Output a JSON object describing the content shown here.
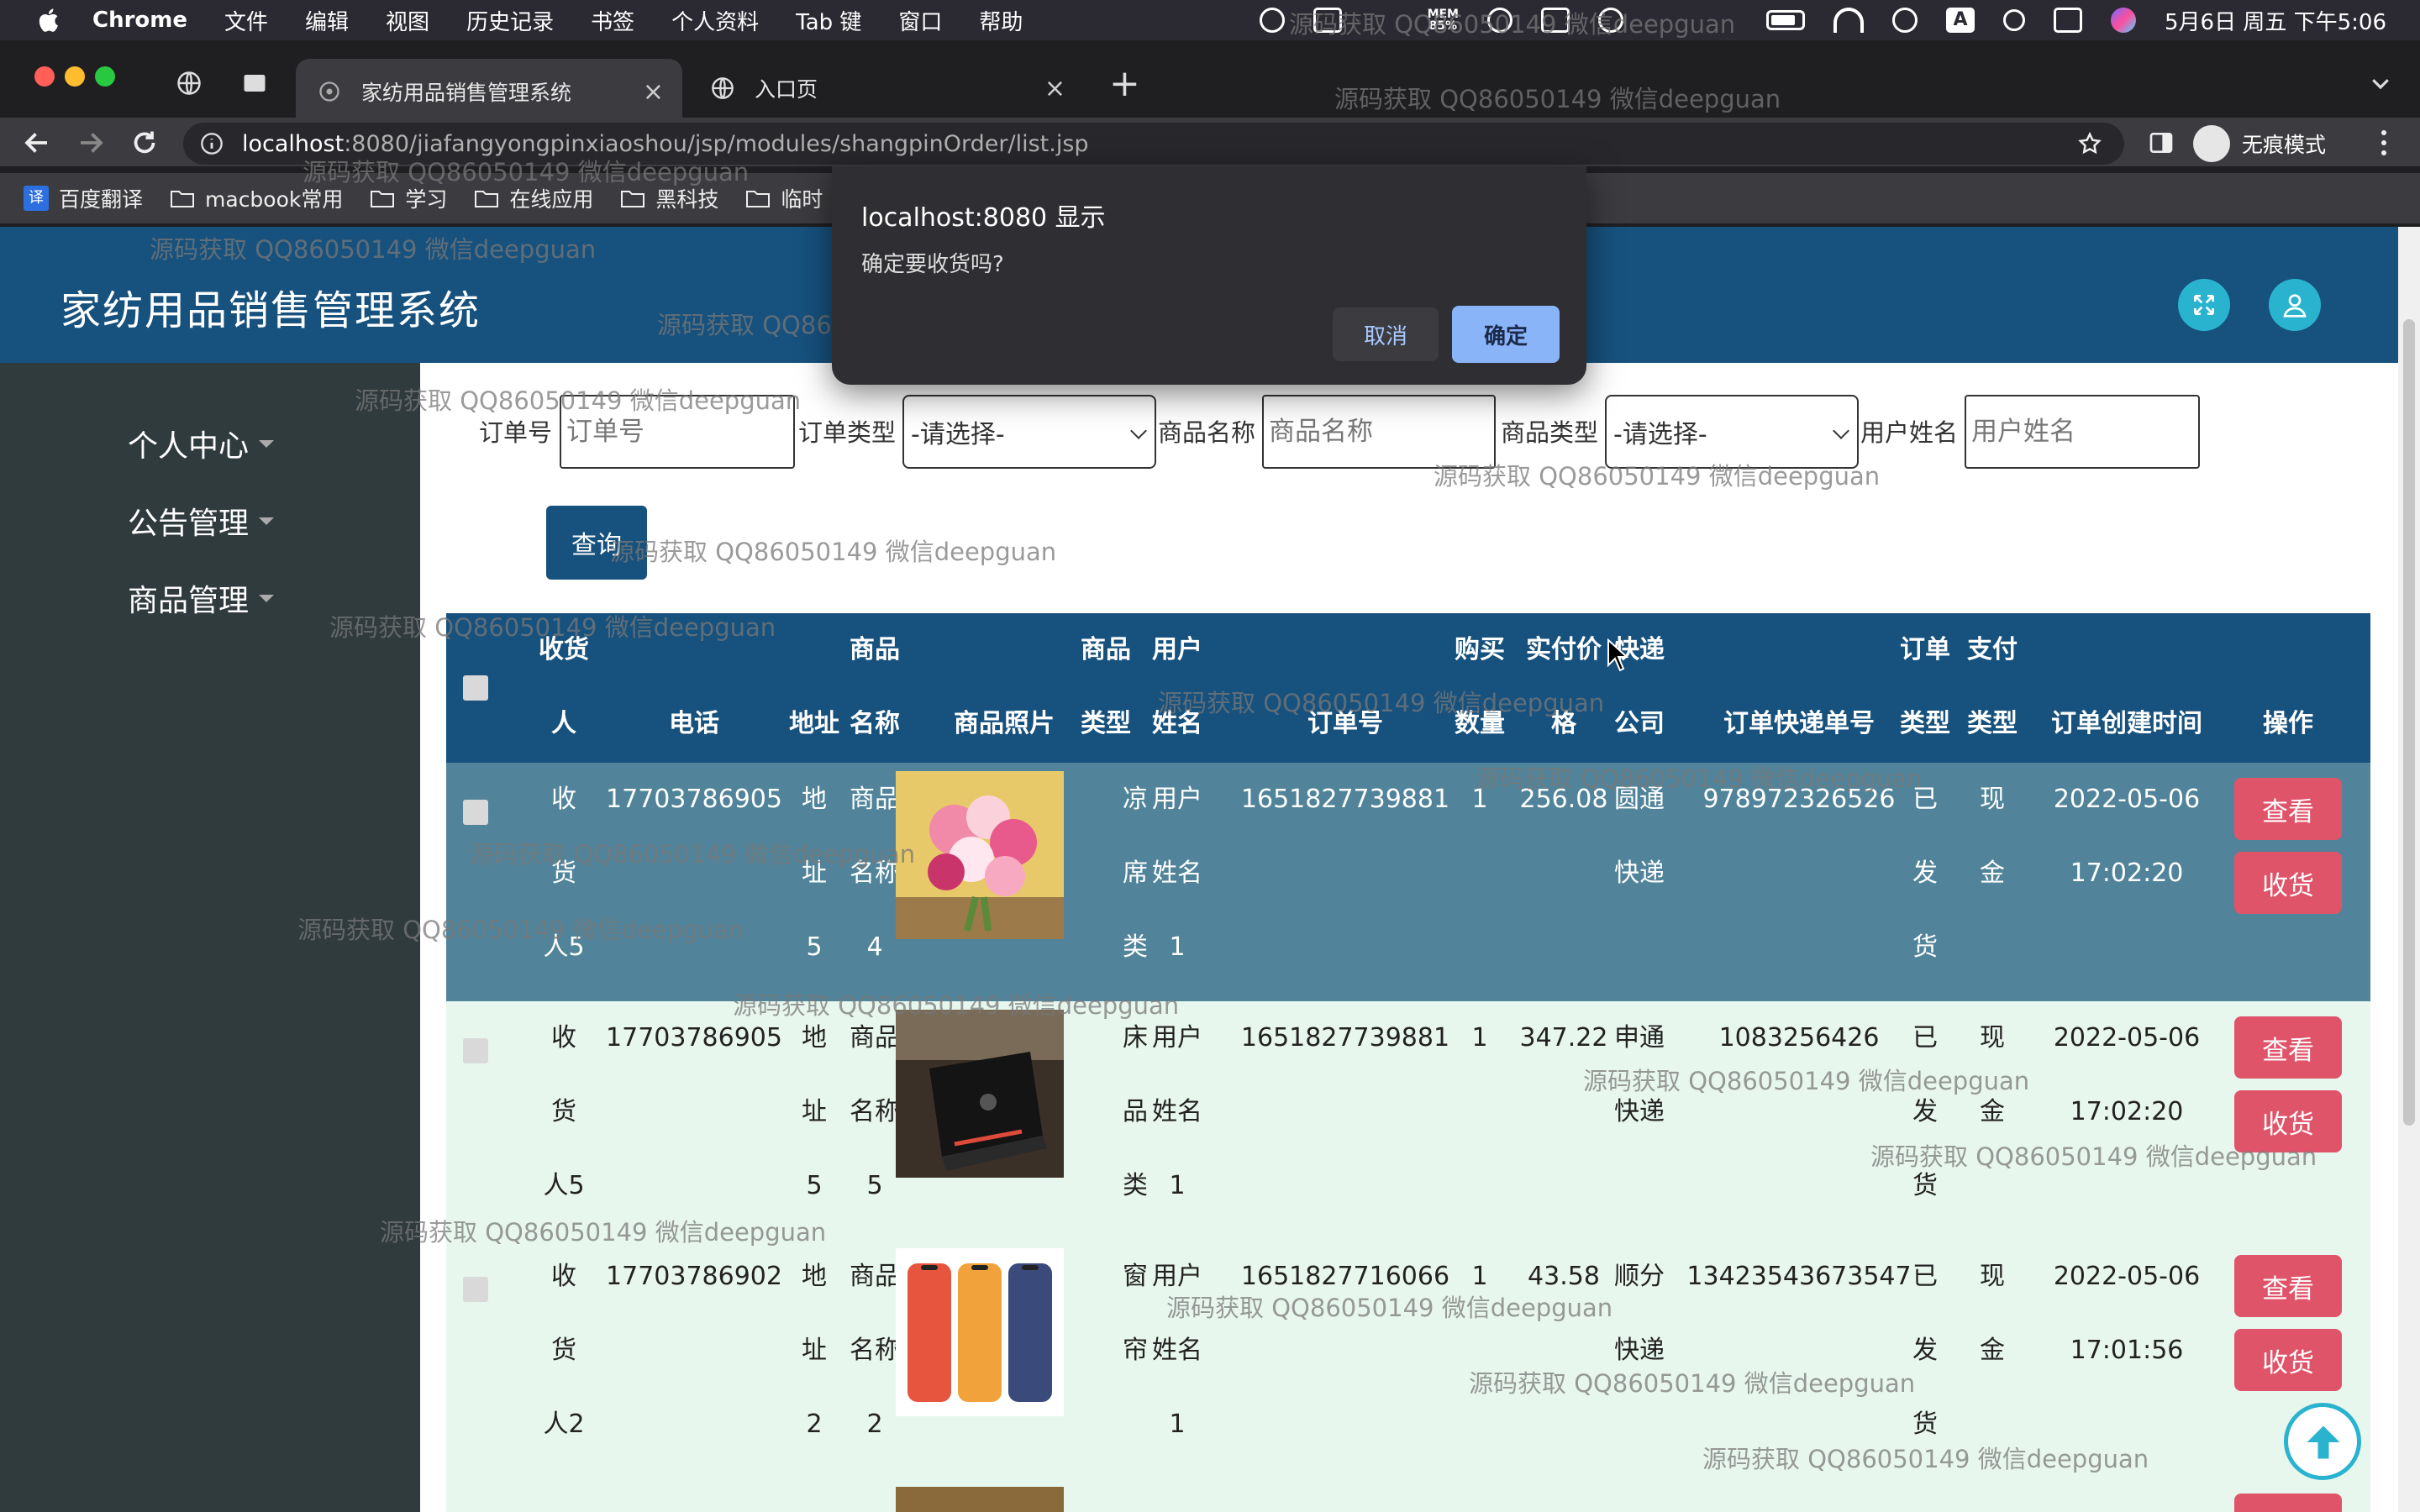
{
  "menubar": {
    "app": "Chrome",
    "items": [
      "文件",
      "编辑",
      "视图",
      "历史记录",
      "书签",
      "个人资料",
      "Tab 键",
      "窗口",
      "帮助"
    ],
    "mem_label": "MEM",
    "mem_value": "85%",
    "clock": "5月6日 周五 下午5:06"
  },
  "tabs": [
    {
      "title": "家纺用品销售管理系统"
    },
    {
      "title": "入口页"
    }
  ],
  "address": {
    "host": "localhost",
    "path": ":8080/jiafangyongpinxiaoshou/jsp/modules/shangpinOrder/list.jsp"
  },
  "incognito_label": "无痕模式",
  "bookmarks": [
    "百度翻译",
    "macbook常用",
    "学习",
    "在线应用",
    "黑科技",
    "临时"
  ],
  "bookmark_icon_text": "译",
  "app": {
    "title": "家纺用品销售管理系统",
    "sidebar": [
      "个人中心",
      "公告管理",
      "商品管理"
    ]
  },
  "filters": {
    "order_no": {
      "label": "订单号",
      "placeholder": "订单号"
    },
    "order_type": {
      "label": "订单类型",
      "value": "-请选择-"
    },
    "product_name": {
      "label": "商品名称",
      "placeholder": "商品名称"
    },
    "product_type": {
      "label": "商品类型",
      "value": "-请选择-"
    },
    "user_name": {
      "label": "用户姓名",
      "placeholder": "用户姓名"
    },
    "query_button": "查询"
  },
  "table": {
    "headers": {
      "receiver": [
        "收货",
        "人"
      ],
      "phone": "电话",
      "address": "地址",
      "product_name": [
        "商品",
        "名称"
      ],
      "photo": "商品照片",
      "product_type": [
        "商品",
        "类型"
      ],
      "user_name": [
        "用户",
        "姓名"
      ],
      "order_no": "订单号",
      "qty": [
        "购买",
        "数量"
      ],
      "price": [
        "实付价",
        "格"
      ],
      "courier": [
        "快递",
        "公司"
      ],
      "tracking": "订单快递单号",
      "order_type": [
        "订单",
        "类型"
      ],
      "pay_type": [
        "支付",
        "类型"
      ],
      "created": "订单创建时间",
      "ops": "操作"
    },
    "rows": [
      {
        "receiver": [
          "收",
          "货",
          "人5"
        ],
        "phone": "17703786905",
        "address": [
          "地",
          "址",
          "5"
        ],
        "product_name": [
          "商品",
          "名称",
          "4"
        ],
        "product_type": [
          "凉",
          "席",
          "类"
        ],
        "user_name": [
          "用户",
          "姓名",
          "1"
        ],
        "order_no": "1651827739881",
        "qty": "1",
        "price": "256.08",
        "courier": [
          "圆通",
          "快递"
        ],
        "tracking": "978972326526",
        "order_type": [
          "已",
          "发",
          "货"
        ],
        "pay_type": [
          "现",
          "金"
        ],
        "created": [
          "2022-05-06",
          "17:02:20"
        ],
        "view": "查看",
        "receive": "收货"
      },
      {
        "receiver": [
          "收",
          "货",
          "人5"
        ],
        "phone": "17703786905",
        "address": [
          "地",
          "址",
          "5"
        ],
        "product_name": [
          "商品",
          "名称",
          "5"
        ],
        "product_type": [
          "床",
          "品",
          "类"
        ],
        "user_name": [
          "用户",
          "姓名",
          "1"
        ],
        "order_no": "1651827739881",
        "qty": "1",
        "price": "347.22",
        "courier": [
          "申通",
          "快递"
        ],
        "tracking": "1083256426",
        "order_type": [
          "已",
          "发",
          "货"
        ],
        "pay_type": [
          "现",
          "金"
        ],
        "created": [
          "2022-05-06",
          "17:02:20"
        ],
        "view": "查看",
        "receive": "收货"
      },
      {
        "receiver": [
          "收",
          "货",
          "人2"
        ],
        "phone": "17703786902",
        "address": [
          "地",
          "址",
          "2"
        ],
        "product_name": [
          "商品",
          "名称",
          "2"
        ],
        "product_type": [
          "窗",
          "帘",
          ""
        ],
        "user_name": [
          "用户",
          "姓名",
          "1"
        ],
        "order_no": "1651827716066",
        "qty": "1",
        "price": "43.58",
        "courier": [
          "顺分",
          "快递"
        ],
        "tracking": "13423543673547",
        "order_type": [
          "已",
          "发",
          "货"
        ],
        "pay_type": [
          "现",
          "金"
        ],
        "created": [
          "2022-05-06",
          "17:01:56"
        ],
        "view": "查看",
        "receive": "收货"
      }
    ]
  },
  "dialog": {
    "title": "localhost:8080 显示",
    "message": "确定要收货吗?",
    "cancel": "取消",
    "ok": "确定"
  },
  "watermark": "源码获取 QQ86050149 微信deepguan",
  "colors": {
    "header": "#17517d",
    "sidebar": "#2f3b3d",
    "row_highlight": "#51849a",
    "row_alt": "#e8f7ee",
    "op_button": "#e0546a",
    "header_icon": "#2ab3cf"
  }
}
